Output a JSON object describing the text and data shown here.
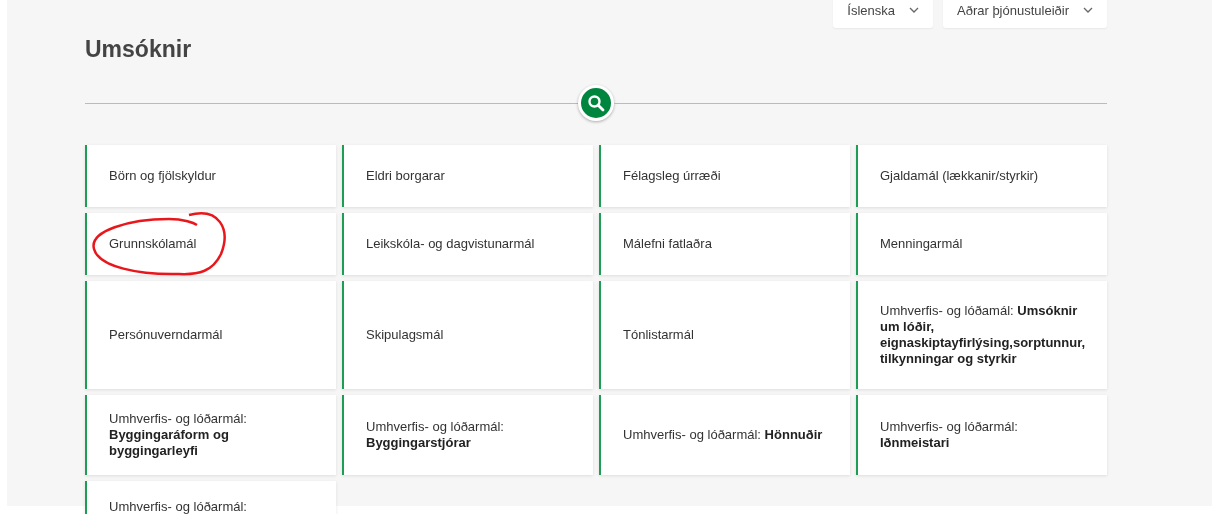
{
  "header": {
    "dropdowns": [
      {
        "label": "Íslenska"
      },
      {
        "label": "Aðrar þjónustuleiðir"
      }
    ]
  },
  "title": "Umsóknir",
  "cards": [
    {
      "label": "Börn og fjölskyldur",
      "circled": false
    },
    {
      "label": "Eldri borgarar",
      "circled": false
    },
    {
      "label": "Félagsleg úrræði",
      "circled": false
    },
    {
      "label": "Gjaldamál (lækkanir/styrkir)",
      "circled": false
    },
    {
      "label": "Grunnskólamál",
      "circled": true
    },
    {
      "label": "Leikskóla- og dagvistunarmál",
      "circled": false
    },
    {
      "label": "Málefni fatlaðra",
      "circled": false
    },
    {
      "label": "Menningarmál",
      "circled": false
    },
    {
      "label": "Persónuverndarmál",
      "circled": false
    },
    {
      "label": "Skipulagsmál",
      "circled": false
    },
    {
      "label": "Tónlistarmál",
      "circled": false
    },
    {
      "label": "Umhverfis- og lóðamál: **Umsóknir um lóðir, eignaskiptayfirlýsing,sorptunnur, tilkynningar og styrkir**",
      "circled": false
    },
    {
      "label": "Umhverfis- og lóðarmál: **Byggingaráform og byggingarleyfi**",
      "circled": false
    },
    {
      "label": "Umhverfis- og lóðarmál: **Byggingarstjórar**",
      "circled": false
    },
    {
      "label": "Umhverfis- og lóðarmál: **Hönnuðir**",
      "circled": false
    },
    {
      "label": "Umhverfis- og lóðarmál: **Iðnmeistari**",
      "circled": false
    },
    {
      "label": "Umhverfis- og lóðarmál:",
      "circled": false
    }
  ]
}
